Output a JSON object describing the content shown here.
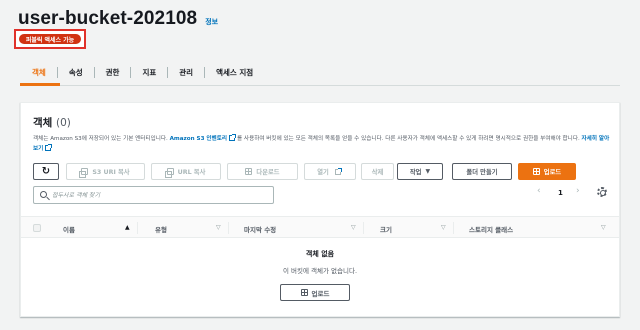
{
  "header": {
    "bucket_name": "user-bucket-202108",
    "info_link": "정보",
    "public_badge": "퍼블릭 액세스 가능"
  },
  "tabs": [
    {
      "label": "객체",
      "active": true
    },
    {
      "label": "속성"
    },
    {
      "label": "권한"
    },
    {
      "label": "지표"
    },
    {
      "label": "관리"
    },
    {
      "label": "액세스 지점"
    }
  ],
  "panel": {
    "title": "객체",
    "count": "(0)",
    "desc_part1": "객체는 Amazon S3에 저장되어 있는 기본 엔터티입니다. ",
    "inventory_link": "Amazon S3 인벤토리",
    "desc_part2": "를 사용하여 버킷에 있는 모든 객체의 목록을 얻을 수 있습니다. 다른 사용자가 객체에 액세스할 수 있게 하려면 명시적으로 권한을 부여해야 합니다.",
    "learn_more": "자세히 알아보기"
  },
  "toolbar": {
    "copy_s3_uri": "S3 URI 복사",
    "copy_url": "URL 복사",
    "download": "다운로드",
    "open": "열기",
    "delete": "삭제",
    "actions": "작업",
    "create_folder": "폴더 만들기",
    "upload": "업로드"
  },
  "search": {
    "placeholder": "접두사로 객체 찾기"
  },
  "pagination": {
    "page": "1",
    "prev": "‹",
    "next": "›"
  },
  "table": {
    "columns": [
      "이름",
      "유형",
      "마지막 수정",
      "크기",
      "스토리지 클래스"
    ]
  },
  "empty": {
    "title": "객체 없음",
    "desc": "이 버킷에 객체가 없습니다.",
    "upload": "업로드"
  },
  "colors": {
    "accent": "#ec7211",
    "public_badge": "#d13212",
    "link": "#0073bb"
  }
}
